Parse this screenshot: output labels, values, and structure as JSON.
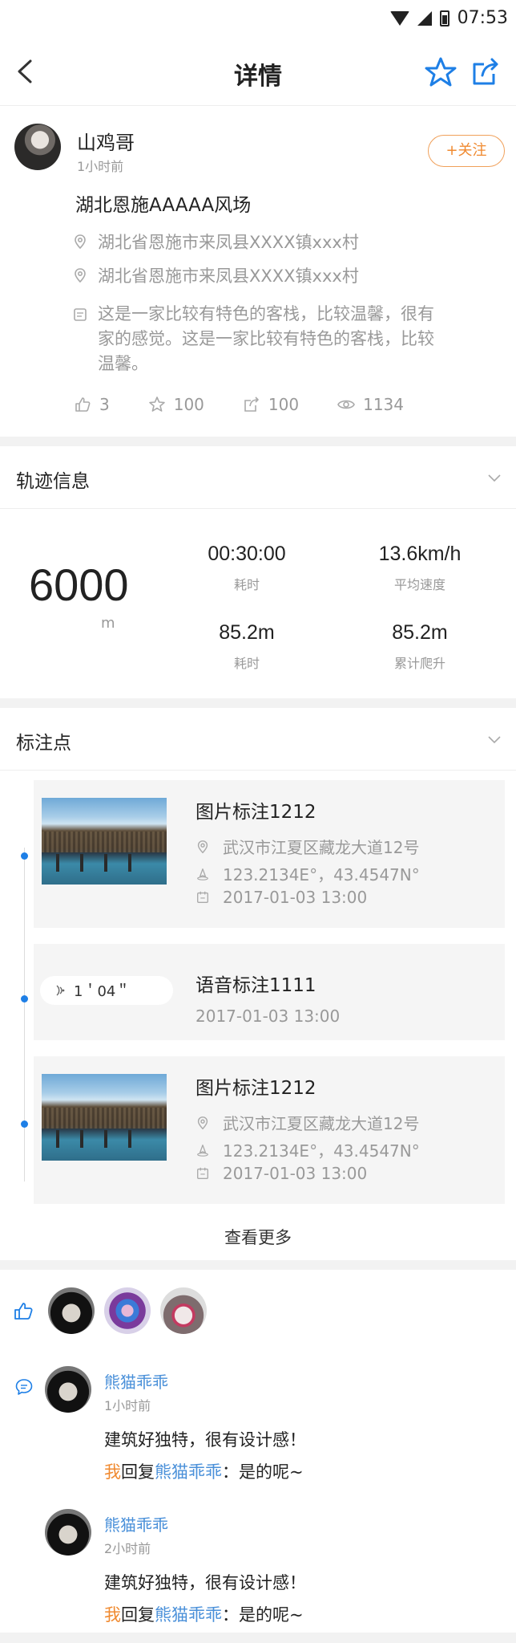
{
  "status_bar": {
    "time": "07:53"
  },
  "header": {
    "title": "详情"
  },
  "post": {
    "author": "山鸡哥",
    "time": "1小时前",
    "follow_label": "+关注",
    "title": "湖北恩施AAAAA风场",
    "locations": [
      "湖北省恩施市来凤县XXXX镇xxx村",
      "湖北省恩施市来凤县XXXX镇xxx村"
    ],
    "description": "这是一家比较有特色的客栈，比较温馨，很有家的感觉。这是一家比较有特色的客栈，比较温馨。",
    "stats": {
      "likes": "3",
      "favorites": "100",
      "shares": "100",
      "views": "1134"
    }
  },
  "track": {
    "section_title": "轨迹信息",
    "distance": "6000",
    "distance_unit": "m",
    "metrics": [
      {
        "value": "00:30:00",
        "label": "耗时"
      },
      {
        "value": "13.6km/h",
        "label": "平均速度"
      },
      {
        "value": "85.2m",
        "label": "耗时"
      },
      {
        "value": "85.2m",
        "label": "累计爬升"
      }
    ]
  },
  "marks": {
    "section_title": "标注点",
    "items": [
      {
        "type": "image",
        "title": "图片标注1212",
        "address": "武汉市江夏区藏龙大道12号",
        "coords": "123.2134E°，43.4547N°",
        "time": "2017-01-03 13:00"
      },
      {
        "type": "voice",
        "title": "语音标注1111",
        "duration": "1＇04＂",
        "time": "2017-01-03 13:00"
      },
      {
        "type": "image",
        "title": "图片标注1212",
        "address": "武汉市江夏区藏龙大道12号",
        "coords": "123.2134E°，43.4547N°",
        "time": "2017-01-03 13:00"
      }
    ],
    "more_label": "查看更多"
  },
  "comments": {
    "items": [
      {
        "name": "熊猫乖乖",
        "time": "1小时前",
        "text": "建筑好独特，很有设计感！",
        "reply_me": "我",
        "reply_word": "回复",
        "reply_to": "熊猫乖乖",
        "reply_text": "：是的呢~"
      },
      {
        "name": "熊猫乖乖",
        "time": "2小时前",
        "text": "建筑好独特，很有设计感！",
        "reply_me": "我",
        "reply_word": "回复",
        "reply_to": "熊猫乖乖",
        "reply_text": "：是的呢~"
      }
    ]
  },
  "colors": {
    "accent": "#1e7fe6",
    "follow": "#f08a30",
    "name_link": "#4a90d9"
  }
}
